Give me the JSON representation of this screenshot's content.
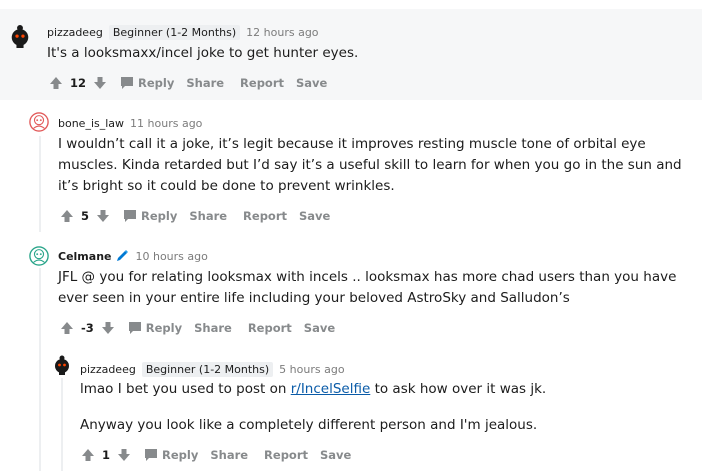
{
  "comments": [
    {
      "author": "pizzadeeg",
      "flair": "Beginner (1-2 Months)",
      "time": "12 hours ago",
      "paragraphs": [
        "It's a looksmaxx/incel joke to get hunter eyes."
      ],
      "score": "12",
      "actions": {
        "reply": "Reply",
        "share": "Share",
        "report": "Report",
        "save": "Save"
      }
    },
    {
      "author": "bone_is_law",
      "time": "11 hours ago",
      "paragraphs": [
        "I wouldn’t call it a joke, it’s legit because it improves resting muscle tone of orbital eye muscles. Kinda retarded but I’d say it’s a useful skill to learn for when you go in the sun and it’s bright so it could be done to prevent wrinkles."
      ],
      "score": "5",
      "actions": {
        "reply": "Reply",
        "share": "Share",
        "report": "Report",
        "save": "Save"
      }
    },
    {
      "author": "Celmane",
      "time": "10 hours ago",
      "paragraphs": [
        "JFL @ you for relating looksmax with incels .. looksmax has more chad users than you have ever seen in your entire life including your beloved AstroSky and Salludon’s"
      ],
      "score": "-3",
      "actions": {
        "reply": "Reply",
        "share": "Share",
        "report": "Report",
        "save": "Save"
      }
    },
    {
      "author": "pizzadeeg",
      "flair": "Beginner (1-2 Months)",
      "time": "5 hours ago",
      "p1_before": "lmao I bet you used to post on ",
      "p1_link": "r/IncelSelfie",
      "p1_after": " to ask how over it was jk.",
      "p2": "Anyway you look like a completely different person and I'm jealous.",
      "score": "1",
      "actions": {
        "reply": "Reply",
        "share": "Share",
        "report": "Report",
        "save": "Save"
      }
    }
  ]
}
